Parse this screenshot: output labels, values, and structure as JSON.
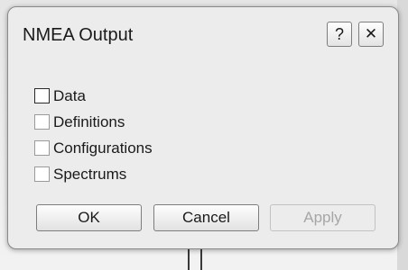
{
  "dialog": {
    "title": "NMEA Output",
    "help_label": "?",
    "close_label": "✕"
  },
  "options": [
    {
      "label": "Data",
      "checked": false
    },
    {
      "label": "Definitions",
      "checked": false
    },
    {
      "label": "Configurations",
      "checked": false
    },
    {
      "label": "Spectrums",
      "checked": false
    }
  ],
  "buttons": {
    "ok": "OK",
    "cancel": "Cancel",
    "apply": "Apply",
    "apply_enabled": false
  }
}
